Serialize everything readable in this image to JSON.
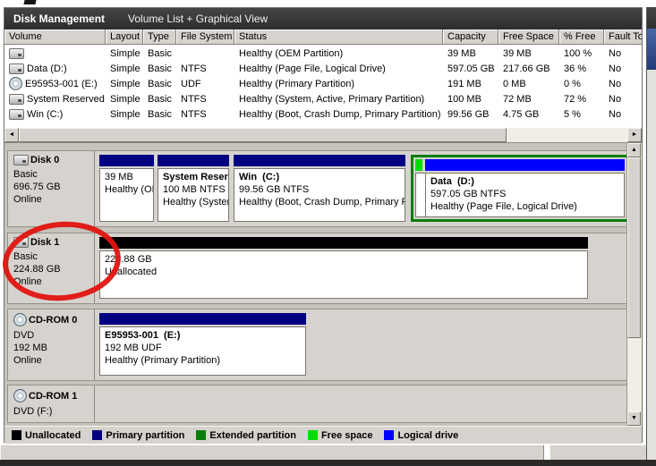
{
  "title_bar": {
    "title": "Disk Management",
    "subtitle": "Volume List + Graphical View"
  },
  "volume_table": {
    "columns": [
      "Volume",
      "Layout",
      "Type",
      "File System",
      "Status",
      "Capacity",
      "Free Space",
      "% Free",
      "Fault Tolerance"
    ],
    "rows": [
      {
        "volume": "",
        "layout": "Simple",
        "type": "Basic",
        "file_system": "",
        "status": "Healthy (OEM Partition)",
        "capacity": "39 MB",
        "free_space": "39 MB",
        "pct_free": "100 %",
        "fault_tolerance": "No",
        "icon": "drive-volume"
      },
      {
        "volume": "Data (D:)",
        "layout": "Simple",
        "type": "Basic",
        "file_system": "NTFS",
        "status": "Healthy (Page File, Logical Drive)",
        "capacity": "597.05 GB",
        "free_space": "217.66 GB",
        "pct_free": "36 %",
        "fault_tolerance": "No",
        "icon": "drive-volume"
      },
      {
        "volume": "E95953-001 (E:)",
        "layout": "Simple",
        "type": "Basic",
        "file_system": "UDF",
        "status": "Healthy (Primary Partition)",
        "capacity": "191 MB",
        "free_space": "0 MB",
        "pct_free": "0 %",
        "fault_tolerance": "No",
        "icon": "optical-disc"
      },
      {
        "volume": "System Reserved",
        "layout": "Simple",
        "type": "Basic",
        "file_system": "NTFS",
        "status": "Healthy (System, Active, Primary Partition)",
        "capacity": "100 MB",
        "free_space": "72 MB",
        "pct_free": "72 %",
        "fault_tolerance": "No",
        "icon": "drive-volume"
      },
      {
        "volume": "Win (C:)",
        "layout": "Simple",
        "type": "Basic",
        "file_system": "NTFS",
        "status": "Healthy (Boot, Crash Dump, Primary Partition)",
        "capacity": "99.56 GB",
        "free_space": "4.75 GB",
        "pct_free": "5 %",
        "fault_tolerance": "No",
        "icon": "drive-volume"
      }
    ]
  },
  "graphical_view": {
    "disks": [
      {
        "name": "Disk 0",
        "kind_label": "Basic",
        "size": "696.75 GB",
        "status": "Online",
        "partitions": [
          {
            "title": "",
            "line1": "39 MB",
            "line2": "Healthy (OEM Partition)"
          },
          {
            "title": "System Reserved",
            "line1": "100 MB NTFS",
            "line2": "Healthy (System, Active, Primary Partition)"
          },
          {
            "title": "Win  (C:)",
            "line1": "99.56 GB NTFS",
            "line2": "Healthy (Boot, Crash Dump, Primary Partition)"
          },
          {
            "title": "Data  (D:)",
            "line1": "597.05 GB NTFS",
            "line2": "Healthy (Page File, Logical Drive)"
          }
        ]
      },
      {
        "name": "Disk 1",
        "kind_label": "Basic",
        "size": "224.88 GB",
        "status": "Online",
        "partitions": [
          {
            "title": "",
            "line1": "224.88 GB",
            "line2": "Unallocated"
          }
        ]
      },
      {
        "name": "CD-ROM 0",
        "kind_label": "DVD",
        "size": "192 MB",
        "status": "Online",
        "partitions": [
          {
            "title": "E95953-001  (E:)",
            "line1": "192 MB UDF",
            "line2": "Healthy (Primary Partition)"
          }
        ]
      },
      {
        "name": "CD-ROM 1",
        "kind_label": "DVD (F:)",
        "size": "",
        "status": "",
        "partitions": []
      }
    ]
  },
  "legend": {
    "items": [
      {
        "label": "Unallocated",
        "color": "#000000"
      },
      {
        "label": "Primary partition",
        "color": "#000080"
      },
      {
        "label": "Extended partition",
        "color": "#0a7d0a"
      },
      {
        "label": "Free space",
        "color": "#00dd00"
      },
      {
        "label": "Logical drive",
        "color": "#0000ff"
      }
    ]
  },
  "colors": {
    "unallocated": "#000000",
    "primary": "#000080",
    "extended": "#0a7d0a",
    "free_space": "#00dd00",
    "logical": "#0000ff",
    "annotation_red": "#e01410"
  },
  "icons": {
    "scroll_up": "▲",
    "scroll_down": "▼",
    "scroll_left": "◄",
    "scroll_right": "►"
  }
}
